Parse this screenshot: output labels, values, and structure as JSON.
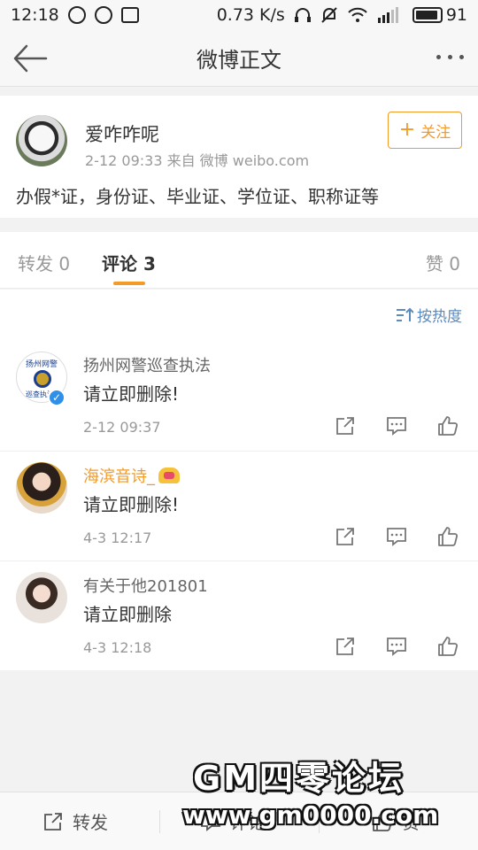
{
  "status_bar": {
    "time": "12:18",
    "speed": "0.73 K/s",
    "battery": "91",
    "icons": [
      "weibo-notification-icon",
      "message-icon",
      "picture-icon",
      "headphones-icon",
      "mute-icon",
      "wifi-icon",
      "signal-icon",
      "battery-icon"
    ]
  },
  "nav": {
    "title": "微博正文"
  },
  "post": {
    "author": "爱咋咋呢",
    "meta": "2-12 09:33  来自 微博 weibo.com",
    "follow_label": "关注",
    "text": "办假*证，身份证、毕业证、学位证、职称证等"
  },
  "tabs": {
    "repost": "转发 0",
    "comment": "评论 3",
    "like": "赞 0"
  },
  "sort": {
    "label": "按热度"
  },
  "comments": [
    {
      "name": "扬州网警巡查执法",
      "text": "请立即删除!",
      "time": "2-12 09:37",
      "avatar_text_top": "扬州网警",
      "avatar_text_bottom": "巡查执法",
      "verified": true
    },
    {
      "name": "海滨音诗_",
      "text": "请立即删除!",
      "time": "4-3 12:17",
      "vip": true
    },
    {
      "name": "有关于他201801",
      "text": "请立即删除",
      "time": "4-3 12:18"
    }
  ],
  "bottom_bar": {
    "repost": "转发",
    "comment": "评论",
    "like": "赞"
  },
  "watermark": {
    "title": "GM四零论坛",
    "url": "www.gm0000.com"
  },
  "colors": {
    "accent": "#f29b28",
    "link": "#5b8bbf",
    "verified": "#2f8fe9"
  }
}
